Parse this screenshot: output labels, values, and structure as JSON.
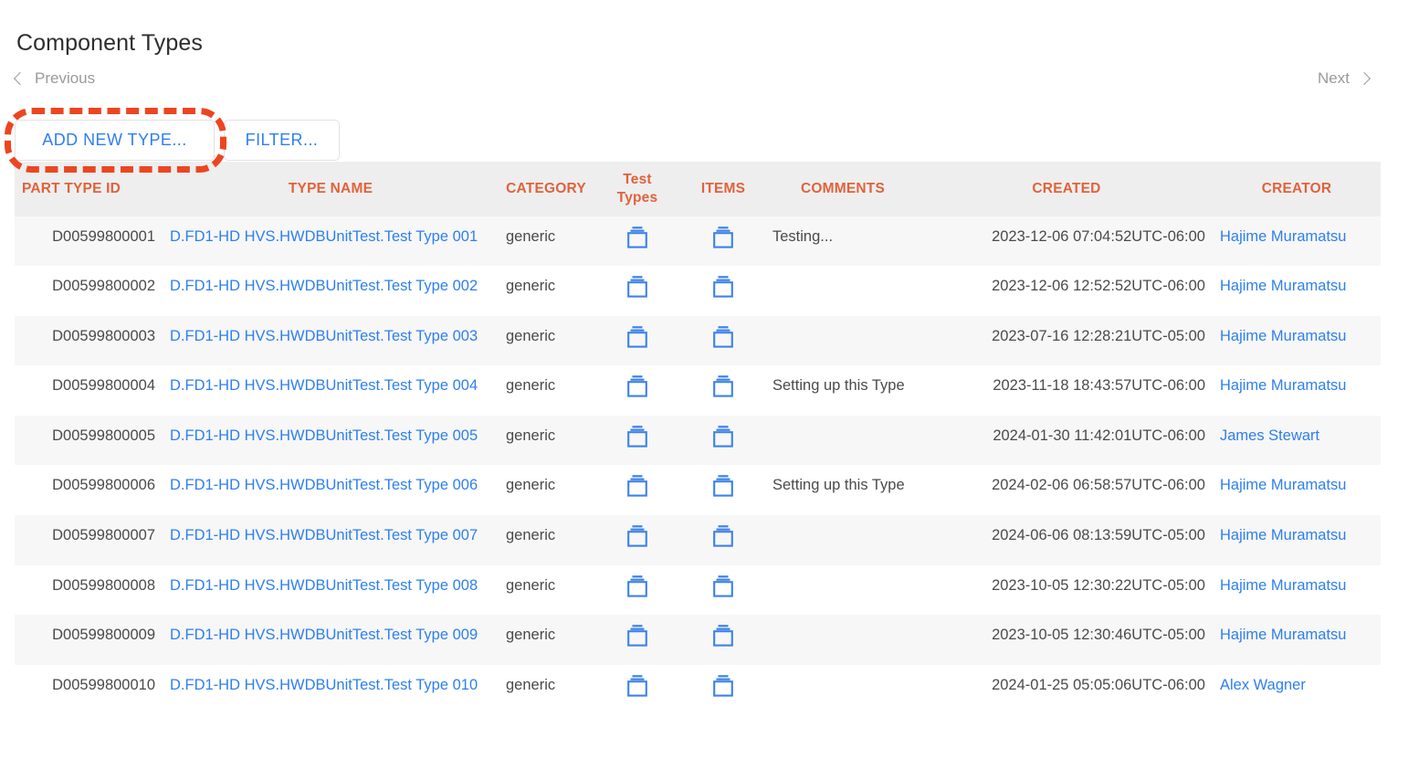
{
  "page": {
    "title": "Component Types"
  },
  "pager": {
    "previous_label": "Previous",
    "next_label": "Next",
    "prev_icon": "chevron-left-icon",
    "next_icon": "chevron-right-icon"
  },
  "toolbar": {
    "add_new_type_label": "ADD NEW TYPE...",
    "filter_label": "FILTER..."
  },
  "highlight": {
    "color": "#ed4520",
    "target": "add-new-type-button"
  },
  "colors": {
    "header_text": "#e0623b",
    "link": "#2d7ff0",
    "header_bg": "#eeeeee",
    "row_alt_bg": "#f7f7f7",
    "icon": "#3b82e8"
  },
  "table": {
    "columns": [
      {
        "key": "part_type_id",
        "label": "PART TYPE ID"
      },
      {
        "key": "type_name",
        "label": "TYPE NAME"
      },
      {
        "key": "category",
        "label": "CATEGORY"
      },
      {
        "key": "test_types",
        "label": "Test Types"
      },
      {
        "key": "items",
        "label": "ITEMS"
      },
      {
        "key": "comments",
        "label": "COMMENTS"
      },
      {
        "key": "created",
        "label": "CREATED"
      },
      {
        "key": "creator",
        "label": "CREATOR"
      }
    ],
    "icon_name": "box-stack-icon",
    "rows": [
      {
        "part_type_id": "D00599800001",
        "type_name": "D.FD1-HD HVS.HWDBUnitTest.Test Type 001",
        "category": "generic",
        "test_types": "box-stack-icon",
        "items": "box-stack-icon",
        "comments": "Testing...",
        "created": "2023-12-06 07:04:52UTC-06:00",
        "creator": "Hajime Muramatsu"
      },
      {
        "part_type_id": "D00599800002",
        "type_name": "D.FD1-HD HVS.HWDBUnitTest.Test Type 002",
        "category": "generic",
        "test_types": "box-stack-icon",
        "items": "box-stack-icon",
        "comments": "",
        "created": "2023-12-06 12:52:52UTC-06:00",
        "creator": "Hajime Muramatsu"
      },
      {
        "part_type_id": "D00599800003",
        "type_name": "D.FD1-HD HVS.HWDBUnitTest.Test Type 003",
        "category": "generic",
        "test_types": "box-stack-icon",
        "items": "box-stack-icon",
        "comments": "",
        "created": "2023-07-16 12:28:21UTC-05:00",
        "creator": "Hajime Muramatsu"
      },
      {
        "part_type_id": "D00599800004",
        "type_name": "D.FD1-HD HVS.HWDBUnitTest.Test Type 004",
        "category": "generic",
        "test_types": "box-stack-icon",
        "items": "box-stack-icon",
        "comments": "Setting up this Type",
        "created": "2023-11-18 18:43:57UTC-06:00",
        "creator": "Hajime Muramatsu"
      },
      {
        "part_type_id": "D00599800005",
        "type_name": "D.FD1-HD HVS.HWDBUnitTest.Test Type 005",
        "category": "generic",
        "test_types": "box-stack-icon",
        "items": "box-stack-icon",
        "comments": "",
        "created": "2024-01-30 11:42:01UTC-06:00",
        "creator": "James Stewart"
      },
      {
        "part_type_id": "D00599800006",
        "type_name": "D.FD1-HD HVS.HWDBUnitTest.Test Type 006",
        "category": "generic",
        "test_types": "box-stack-icon",
        "items": "box-stack-icon",
        "comments": "Setting up this Type",
        "created": "2024-02-06 06:58:57UTC-06:00",
        "creator": "Hajime Muramatsu"
      },
      {
        "part_type_id": "D00599800007",
        "type_name": "D.FD1-HD HVS.HWDBUnitTest.Test Type 007",
        "category": "generic",
        "test_types": "box-stack-icon",
        "items": "box-stack-icon",
        "comments": "",
        "created": "2024-06-06 08:13:59UTC-05:00",
        "creator": "Hajime Muramatsu"
      },
      {
        "part_type_id": "D00599800008",
        "type_name": "D.FD1-HD HVS.HWDBUnitTest.Test Type 008",
        "category": "generic",
        "test_types": "box-stack-icon",
        "items": "box-stack-icon",
        "comments": "",
        "created": "2023-10-05 12:30:22UTC-05:00",
        "creator": "Hajime Muramatsu"
      },
      {
        "part_type_id": "D00599800009",
        "type_name": "D.FD1-HD HVS.HWDBUnitTest.Test Type 009",
        "category": "generic",
        "test_types": "box-stack-icon",
        "items": "box-stack-icon",
        "comments": "",
        "created": "2023-10-05 12:30:46UTC-05:00",
        "creator": "Hajime Muramatsu"
      },
      {
        "part_type_id": "D00599800010",
        "type_name": "D.FD1-HD HVS.HWDBUnitTest.Test Type 010",
        "category": "generic",
        "test_types": "box-stack-icon",
        "items": "box-stack-icon",
        "comments": "",
        "created": "2024-01-25 05:05:06UTC-06:00",
        "creator": "Alex Wagner"
      }
    ]
  }
}
